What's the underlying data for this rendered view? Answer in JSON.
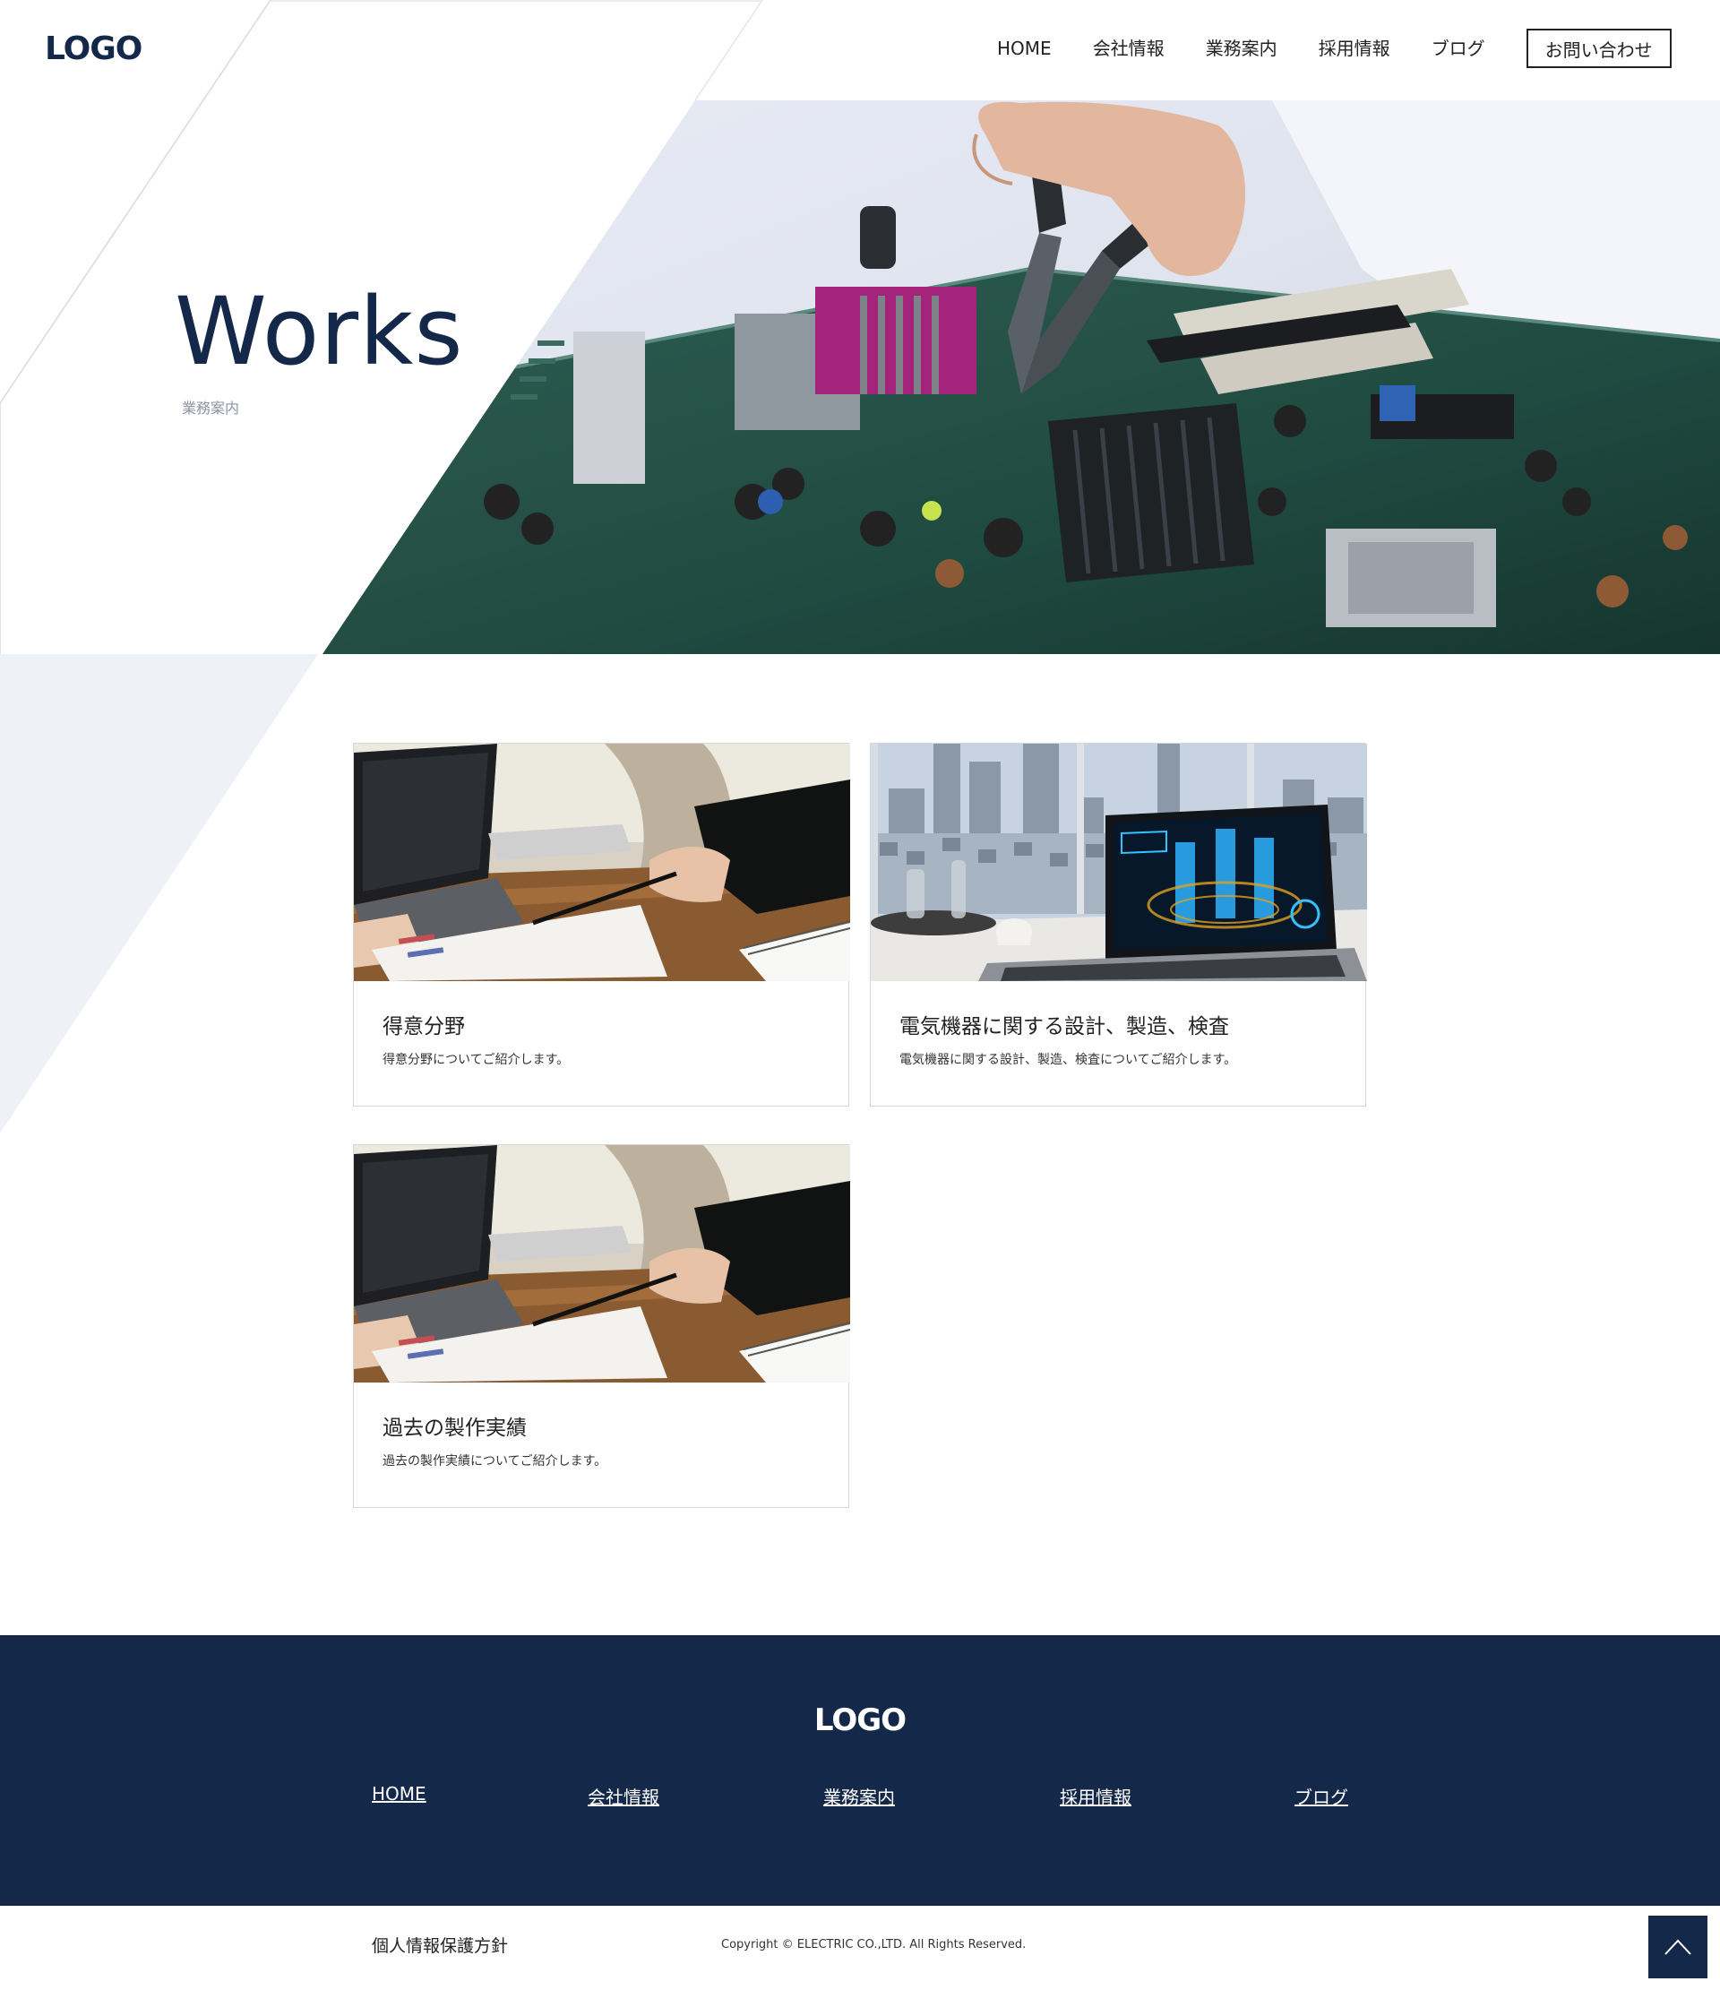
{
  "header": {
    "logo": "LOGO",
    "nav": [
      "HOME",
      "会社情報",
      "業務案内",
      "採用情報",
      "ブログ"
    ],
    "contact_label": "お問い合わせ"
  },
  "hero": {
    "title": "Works",
    "subtitle": "業務案内"
  },
  "cards": [
    {
      "title": "得意分野",
      "description": "得意分野についてご紹介します。",
      "image": "business-meeting-photo"
    },
    {
      "title": "電気機器に関する設計、製造、検査",
      "description": "電気機器に関する設計、製造、検査についてご紹介します。",
      "image": "laptop-hologram-photo"
    },
    {
      "title": "過去の製作実績",
      "description": "過去の製作実績についてご紹介します。",
      "image": "business-meeting-photo"
    }
  ],
  "footer": {
    "logo": "LOGO",
    "links": [
      "HOME",
      "会社情報",
      "業務案内",
      "採用情報",
      "ブログ"
    ],
    "privacy": "個人情報保護方針",
    "copyright": "Copyright © ELECTRIC CO.,LTD. All Rights Reserved.",
    "to_top_icon": "chevron-up-icon"
  },
  "colors": {
    "navy": "#142849",
    "light_bg": "#eef2f7"
  }
}
